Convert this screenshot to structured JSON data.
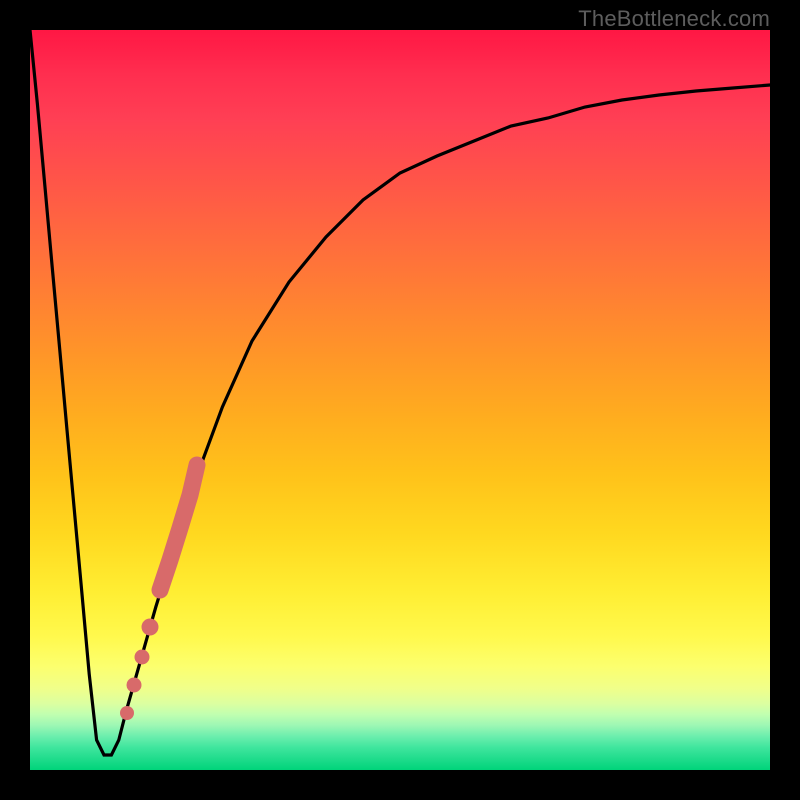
{
  "attribution": "TheBottleneck.com",
  "colors": {
    "frame": "#000000",
    "curve": "#000000",
    "marker": "#d86a6a",
    "gradient_top": "#ff1744",
    "gradient_bottom": "#00d47a"
  },
  "chart_data": {
    "type": "line",
    "title": "",
    "xlabel": "",
    "ylabel": "",
    "xlim": [
      0,
      100
    ],
    "ylim": [
      0,
      100
    ],
    "axes_hidden": true,
    "background": "red-yellow-green vertical gradient",
    "series": [
      {
        "name": "bottleneck-curve",
        "x": [
          0,
          1,
          2,
          3,
          4,
          5,
          6,
          7,
          8,
          9,
          10,
          11,
          12,
          13,
          15,
          17,
          20,
          23,
          26,
          30,
          35,
          40,
          45,
          50,
          55,
          60,
          65,
          70,
          75,
          80,
          85,
          90,
          95,
          100
        ],
        "y": [
          100,
          90,
          79,
          68,
          57,
          46,
          35,
          24,
          13,
          4,
          2,
          2,
          4,
          8,
          15,
          22,
          32,
          41,
          49,
          58,
          66,
          72,
          77,
          81,
          83,
          85,
          87,
          88,
          89.5,
          90.5,
          91.2,
          91.8,
          92.2,
          92.5
        ]
      }
    ],
    "markers": [
      {
        "name": "highlight-upper",
        "x_range": [
          17.5,
          22.0
        ],
        "y_range": [
          24,
          44
        ],
        "style": "thick-segment"
      },
      {
        "name": "highlight-dot-1",
        "x": 16.0,
        "y": 18.5,
        "r": 1.2
      },
      {
        "name": "highlight-dot-2",
        "x": 15.0,
        "y": 14.5,
        "r": 1.1
      },
      {
        "name": "highlight-dot-3",
        "x": 14.0,
        "y": 11.0,
        "r": 1.1
      },
      {
        "name": "highlight-dot-4",
        "x": 13.0,
        "y": 7.5,
        "r": 1.0
      }
    ]
  }
}
